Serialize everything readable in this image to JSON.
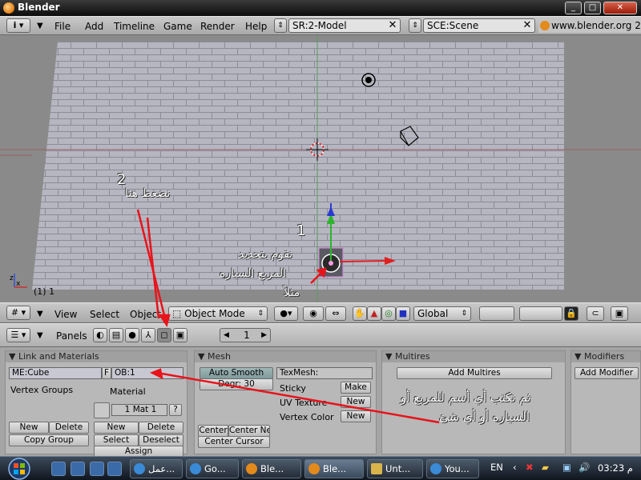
{
  "window": {
    "title": "Blender",
    "minimize": "_",
    "maximize": "□",
    "close": "✕"
  },
  "menubar": {
    "info_icon": "i",
    "items": [
      "File",
      "Add",
      "Timeline",
      "Game",
      "Render",
      "Help"
    ],
    "screen_field": "SR:2-Model",
    "scene_field": "SCE:Scene",
    "url": "www.blender.org 2",
    "close_glyph": "✕"
  },
  "viewport": {
    "frame_label": "(1) 1",
    "axis_x": "x",
    "axis_z": "z"
  },
  "view_header": {
    "items": [
      "View",
      "Select",
      "Object"
    ],
    "mode": "Object Mode",
    "orientation": "Global"
  },
  "buttons_header": {
    "panels_label": "Panels",
    "frame_value": "1"
  },
  "panels": {
    "link_materials": {
      "title": "Link and Materials",
      "mesh_name": "ME:Cube",
      "f_label": "F",
      "object_name": "OB:1",
      "vertex_groups": "Vertex Groups",
      "material_label": "Material",
      "mat_field": "1 Mat 1",
      "question": "?",
      "new": "New",
      "delete": "Delete",
      "copy_group": "Copy Group",
      "select": "Select",
      "deselect": "Deselect",
      "assign": "Assign"
    },
    "mesh": {
      "title": "Mesh",
      "auto_smooth": "Auto Smooth",
      "degr": "Degr: 30",
      "texmesh": "TexMesh:",
      "sticky": "Sticky",
      "make": "Make",
      "uv_texture": "UV Texture",
      "vertex_color": "Vertex Color",
      "new": "New",
      "center": "Center",
      "center_new": "Center Ne",
      "center_cursor": "Center Cursor"
    },
    "multires": {
      "title": "Multires",
      "add": "Add Multires"
    },
    "modifiers": {
      "title": "Modifiers",
      "add": "Add Modifier"
    }
  },
  "taskbar": {
    "tasks": [
      "عمل...",
      "Go...",
      "Ble...",
      "Ble...",
      "Unt...",
      "You..."
    ],
    "lang": "EN",
    "time": "03:23 م"
  },
  "annotations": {
    "num1": "1",
    "num2": "2",
    "text_click_here": "نضغط هنا",
    "text_select_1": "نقوم بتحديد",
    "text_select_2": "المربع السياره",
    "text_select_3": "مثلاً",
    "text_name_1": "ثم نكتب أي أسم للمربع أو",
    "text_name_2": "السياره أو أي شئ"
  },
  "colors": {
    "viewport_bg": "#8a8a8a",
    "floor": "#b4b4bf",
    "accent_arrow": "#e8131b"
  }
}
